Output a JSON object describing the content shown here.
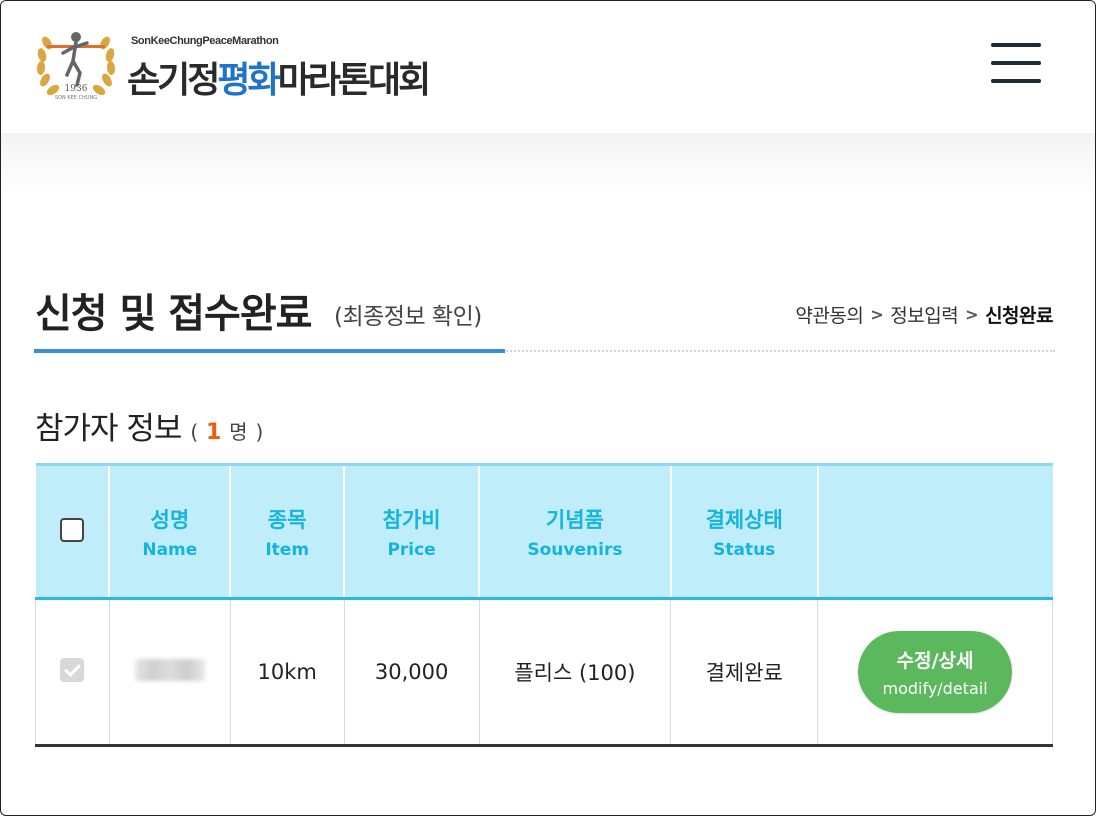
{
  "header": {
    "logo_sub": "SonKeeChungPeaceMarathon",
    "logo_title_a": "손기정",
    "logo_title_b": "평화",
    "logo_title_c": "마라톤대회",
    "emblem_year": "1936",
    "emblem_text": "SON KEE CHUNG"
  },
  "page": {
    "title": "신청 및 접수완료",
    "subtitle": "(최종정보 확인)",
    "breadcrumb": [
      "약관동의",
      "정보입력",
      "신청완료"
    ],
    "breadcrumb_separator": ">"
  },
  "section": {
    "title": "참가자 정보",
    "paren_open": "(",
    "count": "1",
    "unit": "명",
    "paren_close": ")"
  },
  "table": {
    "headers": [
      {
        "ko": "성명",
        "en": "Name"
      },
      {
        "ko": "종목",
        "en": "Item"
      },
      {
        "ko": "참가비",
        "en": "Price"
      },
      {
        "ko": "기념품",
        "en": "Souvenirs"
      },
      {
        "ko": "결제상태",
        "en": "Status"
      }
    ],
    "rows": [
      {
        "checked": true,
        "item": "10km",
        "price": "30,000",
        "souvenir": "플리스 (100)",
        "status": "결제완료",
        "action_ko": "수정/상세",
        "action_en": "modify/detail"
      }
    ]
  },
  "colors": {
    "accent_blue": "#3a8fd0",
    "header_cyan": "#bfeefa",
    "header_text": "#16b3dd",
    "count_orange": "#f05a0a",
    "button_green": "#5cb85c"
  },
  "icons": [
    "menu-icon",
    "logo-emblem",
    "checkbox-icon",
    "chevron-right-icon"
  ]
}
